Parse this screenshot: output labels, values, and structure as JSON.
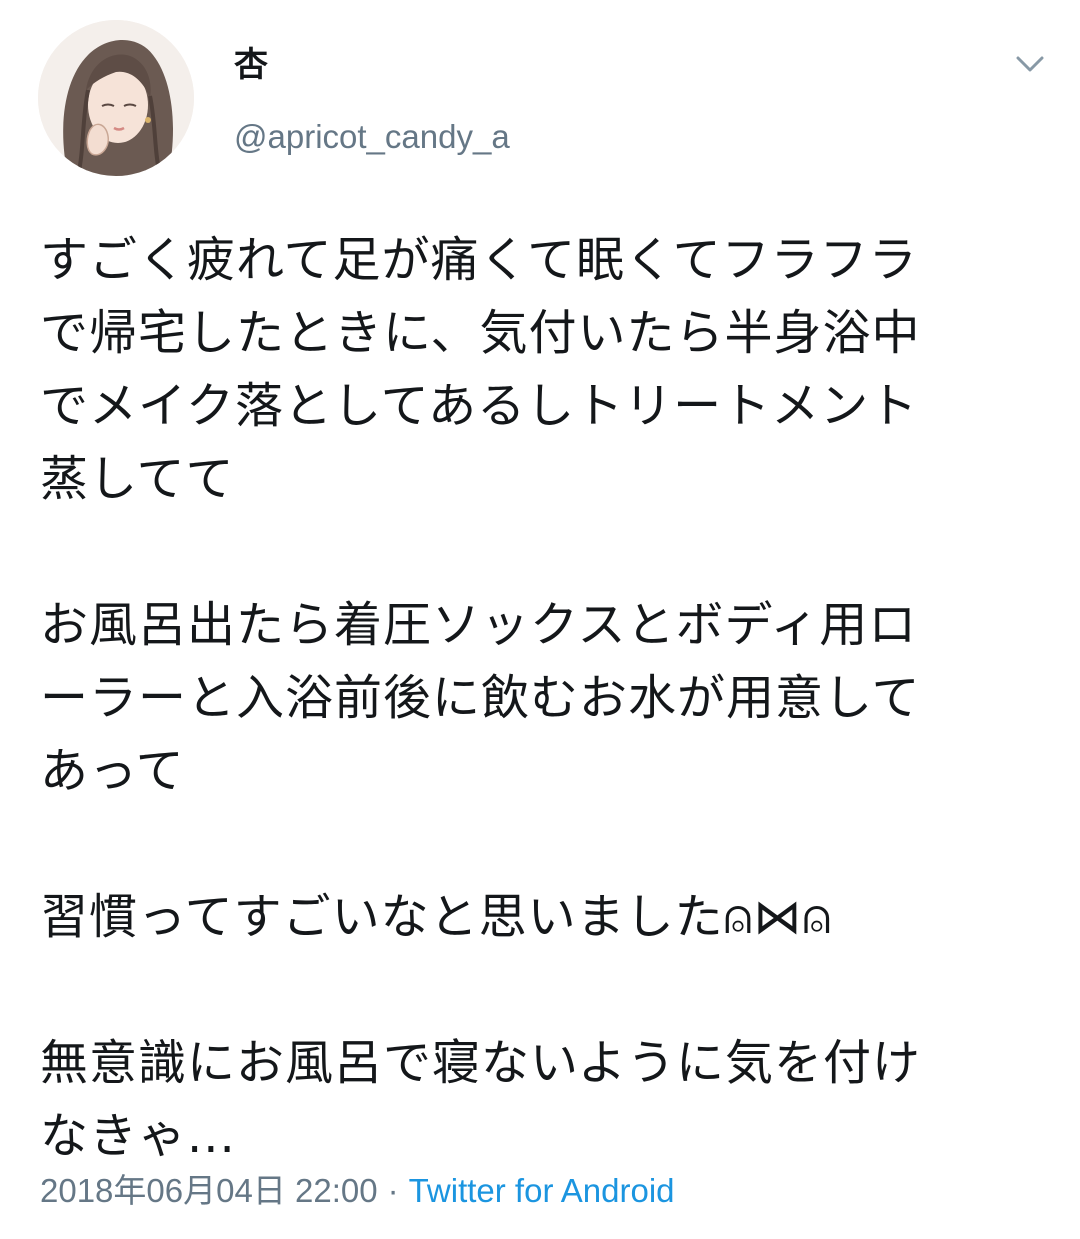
{
  "tweet": {
    "author": {
      "display_name": "杏",
      "handle": "@apricot_candy_a",
      "avatar_icon": "avatar-illustration"
    },
    "menu_icon": "chevron-down-icon",
    "paragraphs": [
      "すごく疲れて足が痛くて眠くてフラフラ\nで帰宅したときに、気付いたら半身浴中\nでメイク落としてあるしトリートメント\n蒸してて",
      "お風呂出たら着圧ソックスとボディ用ロ\nーラーと入浴前後に飲むお水が用意して\nあって",
      "習慣ってすごいなと思いました⍝⋈⍝",
      "無意識にお風呂で寝ないように気を付け\nなきゃ..."
    ],
    "timestamp": "2018年06月04日 22:00",
    "separator": "·",
    "source": "Twitter for Android",
    "colors": {
      "text": "#14171a",
      "secondary": "#657786",
      "link": "#1b95e0"
    }
  }
}
